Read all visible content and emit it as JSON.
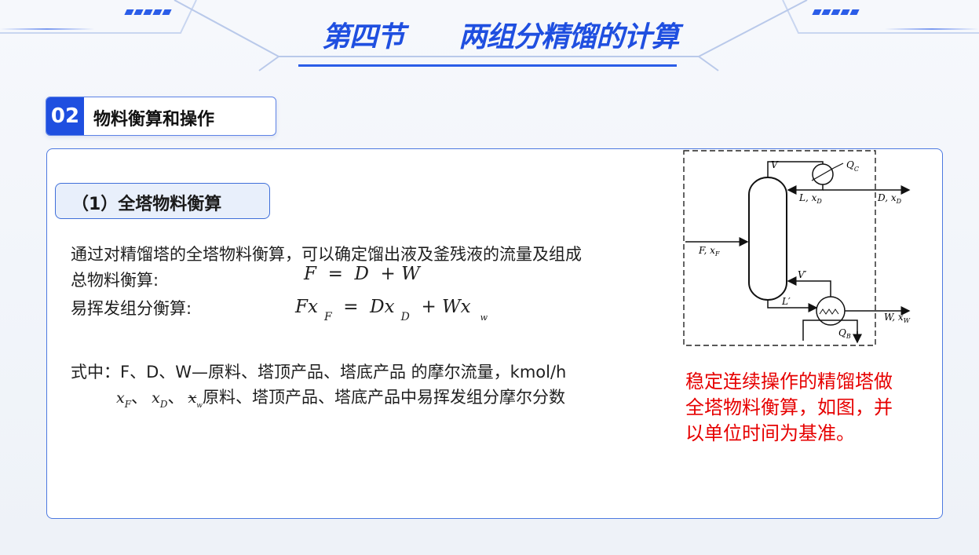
{
  "header": {
    "title": "第四节      两组分精馏的计算"
  },
  "section": {
    "number": "02",
    "title": "物料衡算和操作"
  },
  "subsection": {
    "title": "（1）全塔物料衡算"
  },
  "body": {
    "intro": "通过对精馏塔的全塔物料衡算，可以确定馏出液及釜残液的流量及组成",
    "total_balance_label": "总物料衡算:",
    "total_balance_eq": "F  =  D  + W",
    "volatile_balance_label": "易挥发组分衡算:",
    "volatile_eq": {
      "p1": "Fx",
      "s1": "F",
      "p2": "  =  Dx",
      "s2": "D",
      "p3": "  + Wx",
      "s3": "w"
    },
    "definition_line1": "式中：F、D、W—原料、塔顶产品、塔底产品 的摩尔流量，kmol/h",
    "definition_line2": {
      "x_f": "x",
      "x_f_sub": "F",
      "x_d": "x",
      "x_d_sub": "D",
      "x_w": "x",
      "x_w_sub": "w",
      "sep": "、",
      "text": "原料、塔顶产品、塔底产品中易挥发组分摩尔分数"
    }
  },
  "note": {
    "lines": [
      "稳定连续操作的精馏塔做",
      "全塔物料衡算，如图，并",
      "以单位时间为基准。"
    ]
  },
  "diagram": {
    "labels": {
      "v": "V",
      "qc": "Q",
      "qc_sub": "C",
      "l_xd": "L, x",
      "l_xd_sub": "D",
      "d_xd": "D, x",
      "d_xd_sub": "D",
      "f_xf": "F, x",
      "f_xf_sub": "F",
      "v_prime": "V′",
      "l_prime": "L′",
      "w_xw": "W, x",
      "w_xw_sub": "W",
      "qb": "Q",
      "qb_sub": "B"
    }
  }
}
